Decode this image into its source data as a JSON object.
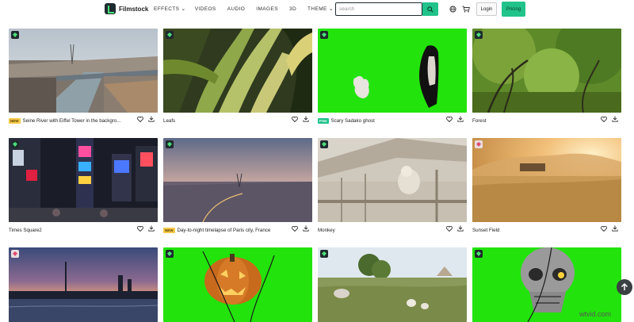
{
  "header": {
    "brand": "Filmstock",
    "nav": [
      {
        "label": "EFFECTS",
        "chevron": true
      },
      {
        "label": "VIDEOS",
        "chevron": false
      },
      {
        "label": "AUDIO",
        "chevron": false
      },
      {
        "label": "IMAGES",
        "chevron": false
      },
      {
        "label": "3D",
        "chevron": false
      },
      {
        "label": "THEME",
        "chevron": true
      }
    ],
    "search_placeholder": "search",
    "login_label": "Login",
    "pricing_label": "Pricing",
    "accent": "#21c38b"
  },
  "cards": [
    {
      "title": "Seine River with Eiffel Tower in the backgro...",
      "tag": "NEW",
      "badge": "green"
    },
    {
      "title": "Leafs",
      "tag": "",
      "badge": "green"
    },
    {
      "title": "Scary Sadako ghost",
      "tag": "Free",
      "badge": "green"
    },
    {
      "title": "Forest",
      "tag": "",
      "badge": "green"
    },
    {
      "title": "Times Square2",
      "tag": "",
      "badge": "green"
    },
    {
      "title": "Day-to-night timelapse of Paris city, France",
      "tag": "NEW",
      "badge": "green"
    },
    {
      "title": "Monkey",
      "tag": "",
      "badge": "green"
    },
    {
      "title": "Sunset Field",
      "tag": "",
      "badge": "pink"
    },
    {
      "title": "",
      "tag": "",
      "badge": "pink"
    },
    {
      "title": "",
      "tag": "",
      "badge": "green"
    },
    {
      "title": "",
      "tag": "",
      "badge": "green"
    },
    {
      "title": "",
      "tag": "",
      "badge": "green"
    }
  ],
  "icons": {
    "like": "heart-icon",
    "download": "download-icon",
    "scroll_top": "arrow-up-icon",
    "language": "globe-icon",
    "cart": "cart-icon"
  },
  "watermark": "wtvid.com"
}
